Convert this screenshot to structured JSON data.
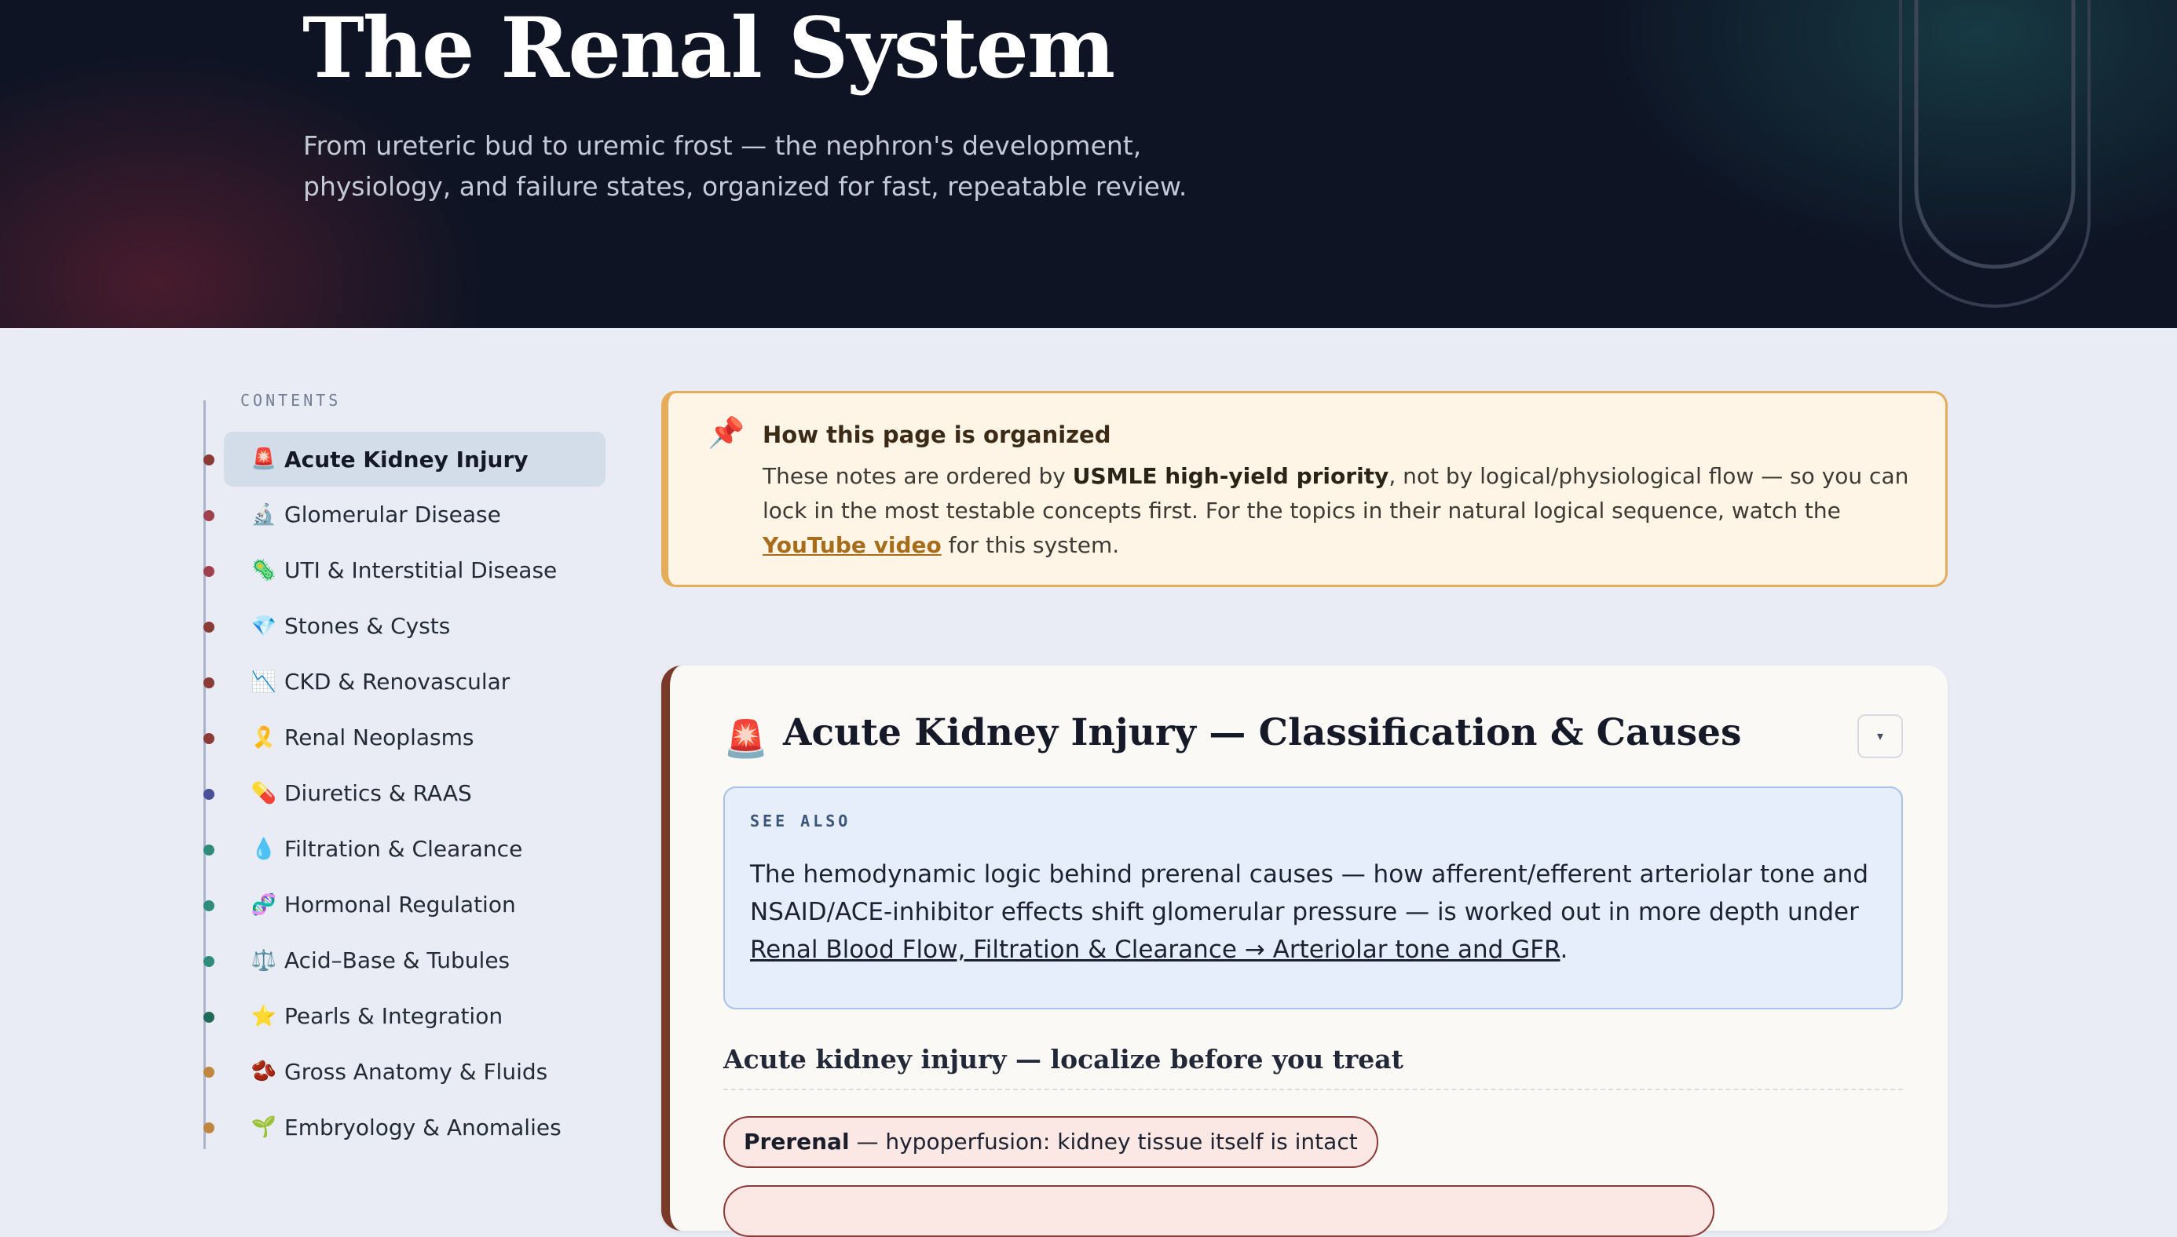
{
  "hero": {
    "title": "The Renal System",
    "subtitle": "From ureteric bud to uremic frost — the nephron's development, physiology, and failure states, organized for fast, repeatable review."
  },
  "sidebar": {
    "heading": "CONTENTS",
    "items": [
      {
        "label": "Acute Kidney Injury",
        "icon": "🚨",
        "icon_name": "siren-icon",
        "dot": "#8a3b36",
        "active": true
      },
      {
        "label": "Glomerular Disease",
        "icon": "🔬",
        "icon_name": "microscope-icon",
        "dot": "#a0404f"
      },
      {
        "label": "UTI & Interstitial Disease",
        "icon": "🦠",
        "icon_name": "microbe-icon",
        "dot": "#a0404f"
      },
      {
        "label": "Stones & Cysts",
        "icon": "💎",
        "icon_name": "gem-icon",
        "dot": "#8a3b36"
      },
      {
        "label": "CKD & Renovascular",
        "icon": "📉",
        "icon_name": "chart-decreasing-icon",
        "dot": "#8a3b36"
      },
      {
        "label": "Renal Neoplasms",
        "icon": "🎗️",
        "icon_name": "ribbon-icon",
        "dot": "#8a3b36"
      },
      {
        "label": "Diuretics & RAAS",
        "icon": "💊",
        "icon_name": "pill-icon",
        "dot": "#4b4f9a"
      },
      {
        "label": "Filtration & Clearance",
        "icon": "💧",
        "icon_name": "droplet-icon",
        "dot": "#2f8c7a"
      },
      {
        "label": "Hormonal Regulation",
        "icon": "🧬",
        "icon_name": "dna-icon",
        "dot": "#2f8c7a"
      },
      {
        "label": "Acid–Base & Tubules",
        "icon": "⚖️",
        "icon_name": "scales-icon",
        "dot": "#2f8c7a"
      },
      {
        "label": "Pearls & Integration",
        "icon": "⭐",
        "icon_name": "star-icon",
        "dot": "#1f6b57"
      },
      {
        "label": "Gross Anatomy & Fluids",
        "icon": "🫘",
        "icon_name": "beans-icon",
        "dot": "#c08640"
      },
      {
        "label": "Embryology & Anomalies",
        "icon": "🌱",
        "icon_name": "seedling-icon",
        "dot": "#c08640"
      }
    ]
  },
  "callout": {
    "icon": "📌",
    "title": "How this page is organized",
    "body_1": "These notes are ordered by ",
    "body_bold": "USMLE high-yield priority",
    "body_2": ", not by logical/physiological flow — so you can lock in the most testable concepts first. For the topics in their natural logical sequence, watch the ",
    "link": "YouTube video",
    "body_3": " for this system.",
    "colors": {
      "border": "#e5ad5a",
      "background": "#fff5e7"
    }
  },
  "section": {
    "icon": "🚨",
    "title": "Acute Kidney Injury — Classification & Causes",
    "collapse_icon": "▾",
    "accent": "#7a3a2a",
    "see_also": {
      "label": "SEE ALSO",
      "body": "The hemodynamic logic behind prerenal causes — how afferent/efferent arteriolar tone and NSAID/ACE-inhibitor effects shift glomerular pressure — is worked out in more depth under ",
      "link": "Renal Blood Flow, Filtration & Clearance → Arteriolar tone and GFR",
      "end": "."
    },
    "subheading": "Acute kidney injury — localize before you treat",
    "pills": [
      {
        "bold": "Prerenal",
        "text": " — hypoperfusion: kidney tissue itself is intact"
      }
    ]
  }
}
